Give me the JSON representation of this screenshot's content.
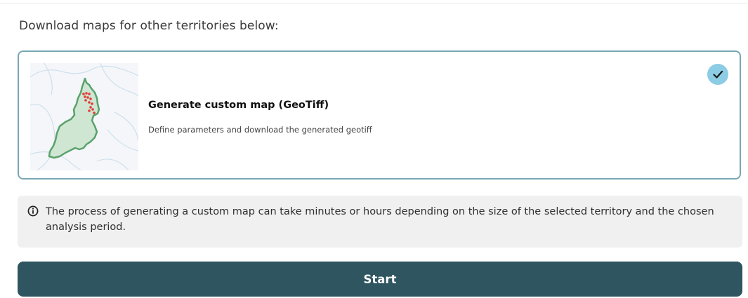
{
  "section": {
    "heading": "Download maps for other territories below:"
  },
  "option_card": {
    "title": "Generate custom map (GeoTiff)",
    "description": "Define parameters and download the generated geotiff",
    "selected": true,
    "thumbnail_icon": "territory-map-thumbnail"
  },
  "info": {
    "icon": "info-icon",
    "text": "The process of generating a custom map can take minutes or hours depending on the size of the selected territory and the chosen analysis period."
  },
  "actions": {
    "start_label": "Start"
  },
  "colors": {
    "card_border": "#77a7b4",
    "check_badge": "#8ccce4",
    "button_bg": "#2e5560",
    "info_bg": "#f0f0f0",
    "territory_fill": "#cfe6d2",
    "territory_stroke": "#5aa26b",
    "hotspot": "#e53935"
  }
}
